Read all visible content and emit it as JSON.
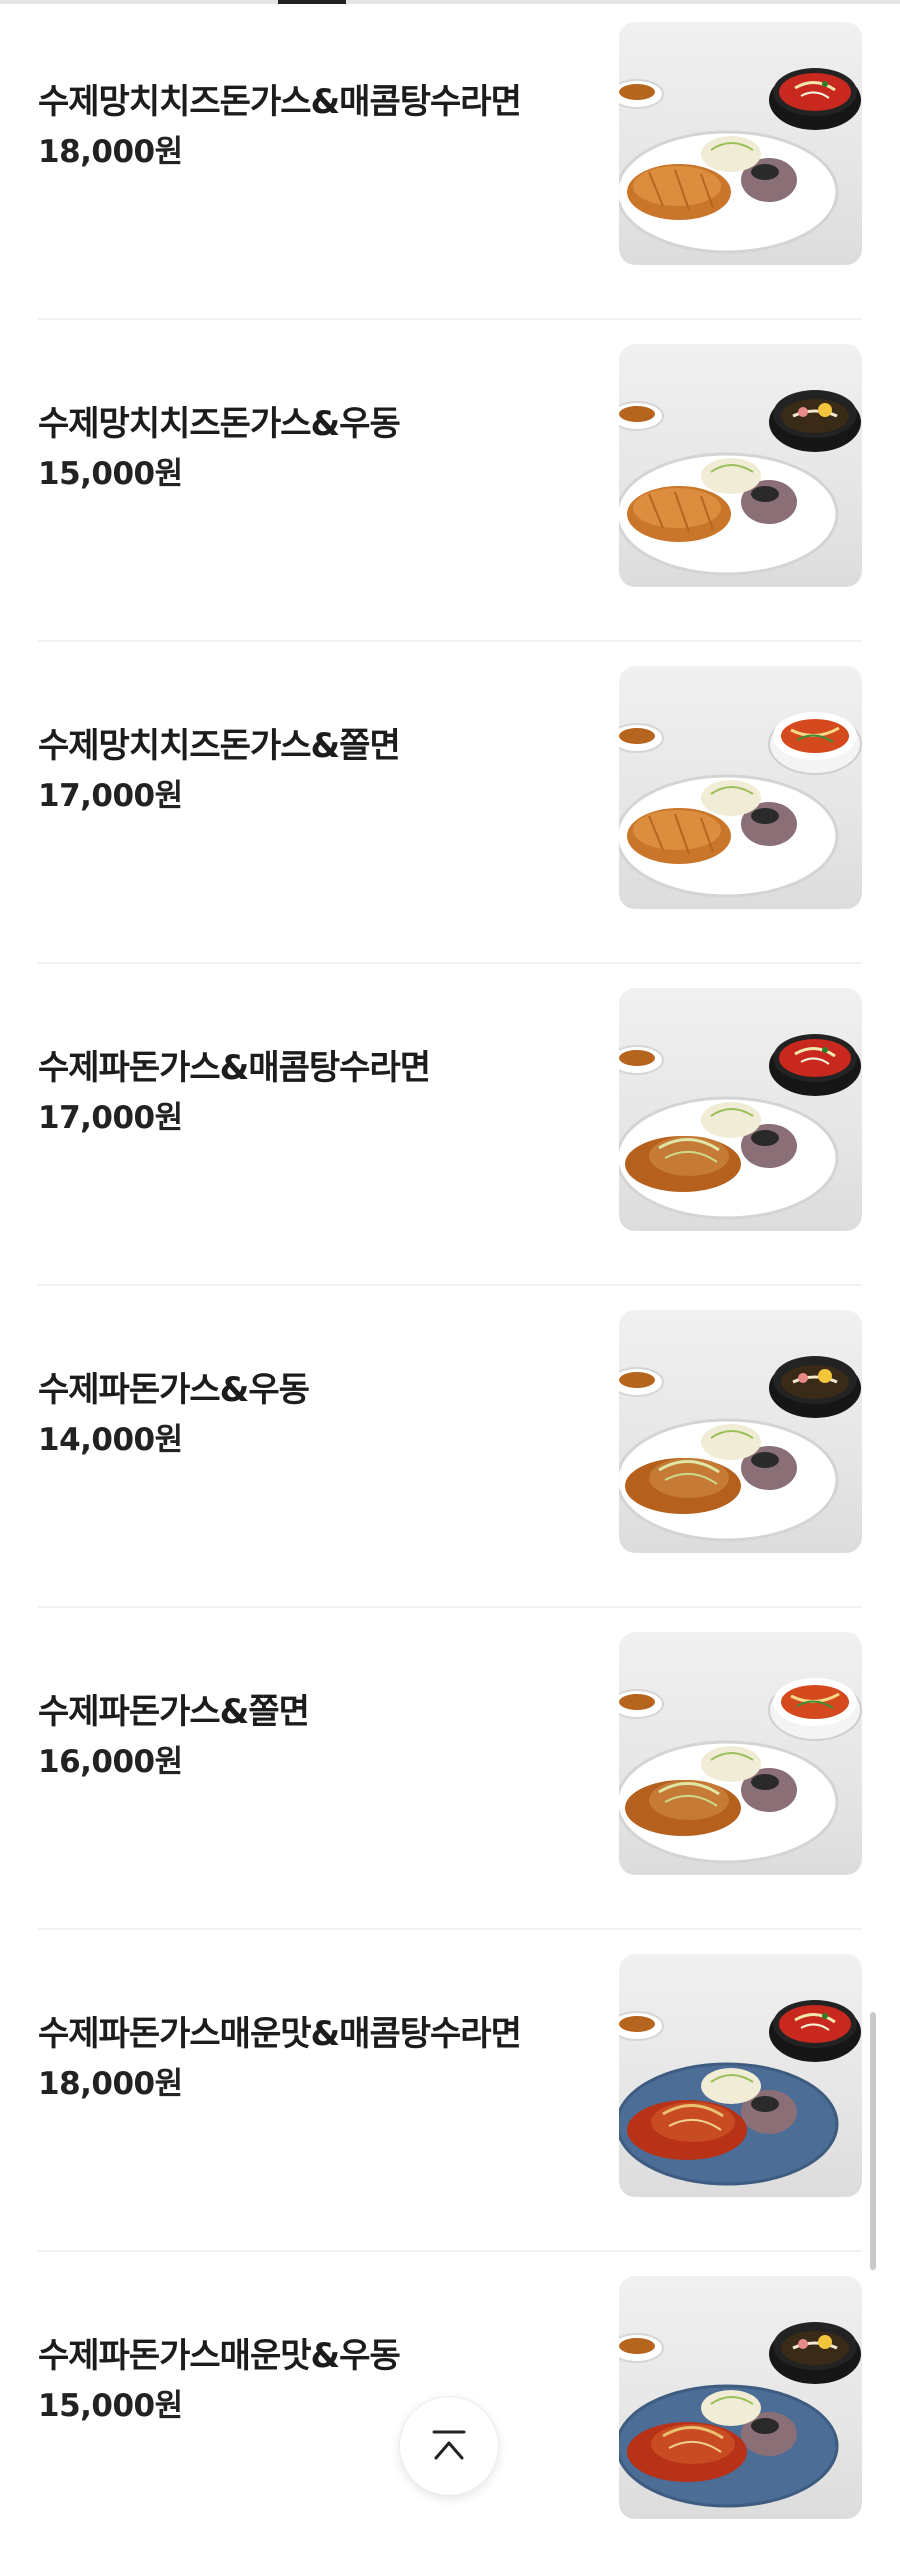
{
  "menu": {
    "items": [
      {
        "name": "수제망치치즈돈가스&매콤탕수라면",
        "price": "18,000원",
        "image": "cheese-cutlet-spicy-ramen-photo"
      },
      {
        "name": "수제망치치즈돈가스&우동",
        "price": "15,000원",
        "image": "cheese-cutlet-udon-photo"
      },
      {
        "name": "수제망치치즈돈가스&쫄면",
        "price": "17,000원",
        "image": "cheese-cutlet-jjolmyeon-photo"
      },
      {
        "name": "수제파돈가스&매콤탕수라면",
        "price": "17,000원",
        "image": "scallion-cutlet-spicy-ramen-photo"
      },
      {
        "name": "수제파돈가스&우동",
        "price": "14,000원",
        "image": "scallion-cutlet-udon-photo"
      },
      {
        "name": "수제파돈가스&쫄면",
        "price": "16,000원",
        "image": "scallion-cutlet-jjolmyeon-photo"
      },
      {
        "name": "수제파돈가스매운맛&매콤탕수라면",
        "price": "18,000원",
        "image": "spicy-scallion-cutlet-spicy-ramen-photo"
      },
      {
        "name": "수제파돈가스매운맛&우동",
        "price": "15,000원",
        "image": "spicy-scallion-cutlet-udon-photo"
      }
    ]
  },
  "controls": {
    "scroll_top_icon": "chevron-up-icon"
  },
  "colors": {
    "text": "#1c1c1c",
    "divider": "#f1f1f1",
    "image_bg": "#e6e6e6",
    "tab_indicator": "#222222"
  }
}
